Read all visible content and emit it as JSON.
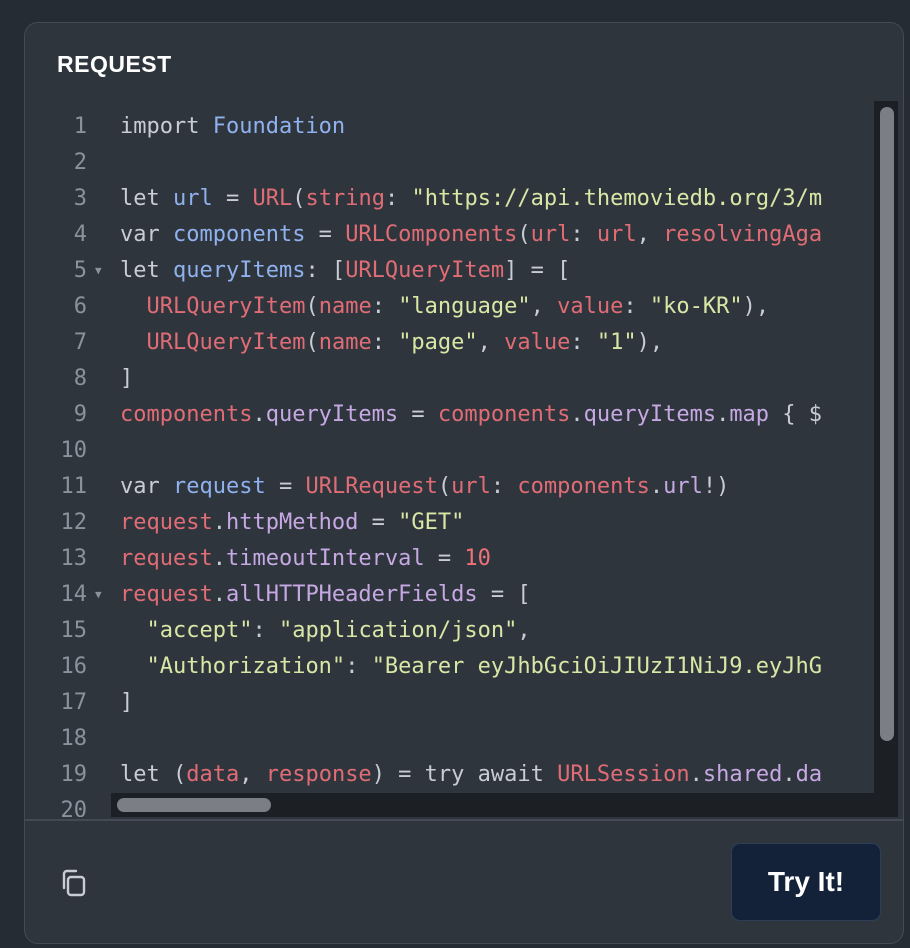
{
  "panel": {
    "title": "REQUEST"
  },
  "code": {
    "lines": [
      {
        "n": "1",
        "fold": false,
        "tokens": [
          [
            "import ",
            "kw"
          ],
          [
            "Foundation",
            "def"
          ]
        ]
      },
      {
        "n": "2",
        "fold": false,
        "tokens": []
      },
      {
        "n": "3",
        "fold": false,
        "tokens": [
          [
            "let ",
            "kw"
          ],
          [
            "url",
            "def"
          ],
          [
            " = ",
            "plain"
          ],
          [
            "URL",
            "type"
          ],
          [
            "(",
            "plain"
          ],
          [
            "string",
            "var"
          ],
          [
            ": ",
            "plain"
          ],
          [
            "\"https://api.themoviedb.org/3/m",
            "str"
          ]
        ]
      },
      {
        "n": "4",
        "fold": false,
        "tokens": [
          [
            "var ",
            "kw"
          ],
          [
            "components",
            "def"
          ],
          [
            " = ",
            "plain"
          ],
          [
            "URLComponents",
            "type"
          ],
          [
            "(",
            "plain"
          ],
          [
            "url",
            "var"
          ],
          [
            ": ",
            "plain"
          ],
          [
            "url",
            "var"
          ],
          [
            ", ",
            "plain"
          ],
          [
            "resolvingAga",
            "var"
          ]
        ]
      },
      {
        "n": "5",
        "fold": true,
        "tokens": [
          [
            "let ",
            "kw"
          ],
          [
            "queryItems",
            "def"
          ],
          [
            ": [",
            "plain"
          ],
          [
            "URLQueryItem",
            "type"
          ],
          [
            "] = [",
            "plain"
          ]
        ]
      },
      {
        "n": "6",
        "fold": false,
        "tokens": [
          [
            "  ",
            "plain"
          ],
          [
            "URLQueryItem",
            "type"
          ],
          [
            "(",
            "plain"
          ],
          [
            "name",
            "var"
          ],
          [
            ": ",
            "plain"
          ],
          [
            "\"language\"",
            "str"
          ],
          [
            ", ",
            "plain"
          ],
          [
            "value",
            "var"
          ],
          [
            ": ",
            "plain"
          ],
          [
            "\"ko-KR\"",
            "str"
          ],
          [
            "),",
            "plain"
          ]
        ]
      },
      {
        "n": "7",
        "fold": false,
        "tokens": [
          [
            "  ",
            "plain"
          ],
          [
            "URLQueryItem",
            "type"
          ],
          [
            "(",
            "plain"
          ],
          [
            "name",
            "var"
          ],
          [
            ": ",
            "plain"
          ],
          [
            "\"page\"",
            "str"
          ],
          [
            ", ",
            "plain"
          ],
          [
            "value",
            "var"
          ],
          [
            ": ",
            "plain"
          ],
          [
            "\"1\"",
            "str"
          ],
          [
            "),",
            "plain"
          ]
        ]
      },
      {
        "n": "8",
        "fold": false,
        "tokens": [
          [
            "]",
            "plain"
          ]
        ]
      },
      {
        "n": "9",
        "fold": false,
        "tokens": [
          [
            "components",
            "var"
          ],
          [
            ".",
            "plain"
          ],
          [
            "queryItems",
            "prop"
          ],
          [
            " = ",
            "plain"
          ],
          [
            "components",
            "var"
          ],
          [
            ".",
            "plain"
          ],
          [
            "queryItems",
            "prop"
          ],
          [
            ".",
            "plain"
          ],
          [
            "map",
            "prop"
          ],
          [
            " { $",
            "plain"
          ]
        ]
      },
      {
        "n": "10",
        "fold": false,
        "tokens": []
      },
      {
        "n": "11",
        "fold": false,
        "tokens": [
          [
            "var ",
            "kw"
          ],
          [
            "request",
            "def"
          ],
          [
            " = ",
            "plain"
          ],
          [
            "URLRequest",
            "type"
          ],
          [
            "(",
            "plain"
          ],
          [
            "url",
            "var"
          ],
          [
            ": ",
            "plain"
          ],
          [
            "components",
            "var"
          ],
          [
            ".",
            "plain"
          ],
          [
            "url",
            "prop"
          ],
          [
            "!)",
            "plain"
          ]
        ]
      },
      {
        "n": "12",
        "fold": false,
        "tokens": [
          [
            "request",
            "var"
          ],
          [
            ".",
            "plain"
          ],
          [
            "httpMethod",
            "prop"
          ],
          [
            " = ",
            "plain"
          ],
          [
            "\"GET\"",
            "str"
          ]
        ]
      },
      {
        "n": "13",
        "fold": false,
        "tokens": [
          [
            "request",
            "var"
          ],
          [
            ".",
            "plain"
          ],
          [
            "timeoutInterval",
            "prop"
          ],
          [
            " = ",
            "plain"
          ],
          [
            "10",
            "num"
          ]
        ]
      },
      {
        "n": "14",
        "fold": true,
        "tokens": [
          [
            "request",
            "var"
          ],
          [
            ".",
            "plain"
          ],
          [
            "allHTTPHeaderFields",
            "prop"
          ],
          [
            " = [",
            "plain"
          ]
        ]
      },
      {
        "n": "15",
        "fold": false,
        "tokens": [
          [
            "  ",
            "plain"
          ],
          [
            "\"accept\"",
            "str"
          ],
          [
            ": ",
            "plain"
          ],
          [
            "\"application/json\"",
            "str"
          ],
          [
            ",",
            "plain"
          ]
        ]
      },
      {
        "n": "16",
        "fold": false,
        "tokens": [
          [
            "  ",
            "plain"
          ],
          [
            "\"Authorization\"",
            "str"
          ],
          [
            ": ",
            "plain"
          ],
          [
            "\"Bearer eyJhbGciOiJIUzI1NiJ9.eyJhG",
            "str"
          ]
        ]
      },
      {
        "n": "17",
        "fold": false,
        "tokens": [
          [
            "]",
            "plain"
          ]
        ]
      },
      {
        "n": "18",
        "fold": false,
        "tokens": []
      },
      {
        "n": "19",
        "fold": false,
        "tokens": [
          [
            "let ",
            "kw"
          ],
          [
            "(",
            "plain"
          ],
          [
            "data",
            "var"
          ],
          [
            ", ",
            "plain"
          ],
          [
            "response",
            "var"
          ],
          [
            ") = ",
            "plain"
          ],
          [
            "try ",
            "kw"
          ],
          [
            "await ",
            "kw"
          ],
          [
            "URLSession",
            "type"
          ],
          [
            ".",
            "plain"
          ],
          [
            "shared",
            "prop"
          ],
          [
            ".",
            "plain"
          ],
          [
            "da",
            "prop"
          ]
        ]
      },
      {
        "n": "20",
        "fold": false,
        "tokens": []
      }
    ]
  },
  "actions": {
    "try_label": "Try It!",
    "copy_icon": "copy-icon"
  },
  "colors": {
    "background": "#262c33",
    "panel": "#2f353d",
    "button": "#142239",
    "variable": "#e06c75",
    "string": "#d7e8a6",
    "property": "#c6a8e3",
    "declaration": "#8fb1ee"
  }
}
